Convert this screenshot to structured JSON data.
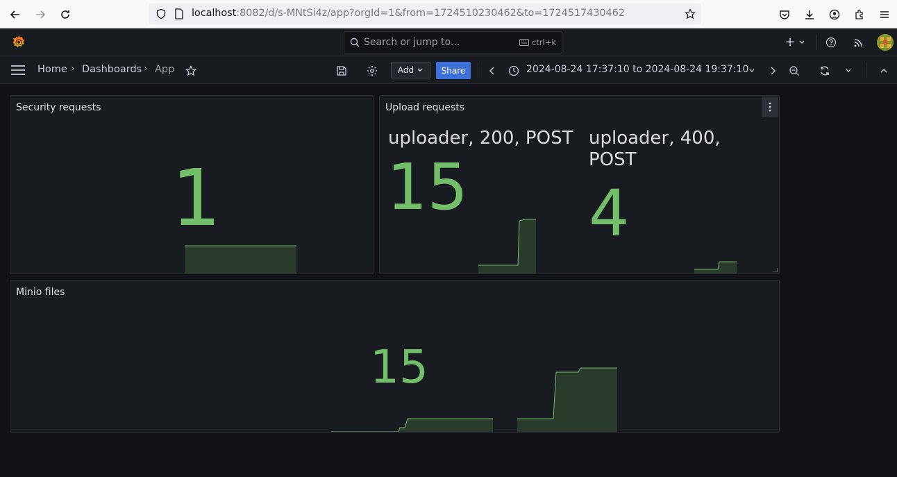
{
  "browser": {
    "url_host": "localhost",
    "url_rest": ":8082/d/s-MNtSi4z/app?orgId=1&from=1724510230462&to=1724517430462"
  },
  "topbar": {
    "search_placeholder": "Search or jump to...",
    "shortcut": "ctrl+k",
    "new_label": "+"
  },
  "navbar": {
    "breadcrumbs": [
      "Home",
      "Dashboards",
      "App"
    ],
    "add_label": "Add",
    "share_label": "Share",
    "time_from": "2024-08-24 17:37:10",
    "time_to_word": "to",
    "time_to": "2024-08-24 19:37:10"
  },
  "panels": {
    "security": {
      "title": "Security requests",
      "value": "1"
    },
    "upload": {
      "title": "Upload requests",
      "stats": [
        {
          "label": "uploader, 200, POST",
          "value": "15"
        },
        {
          "label": "uploader, 400, POST",
          "value": "4"
        }
      ]
    },
    "minio": {
      "title": "Minio files",
      "value": "15"
    }
  },
  "colors": {
    "accent_green": "#73bf69",
    "sparkline_fill": "#2a3b2c",
    "primary_blue": "#3d71d9",
    "panel_bg": "#181b1f",
    "page_bg": "#111217"
  }
}
